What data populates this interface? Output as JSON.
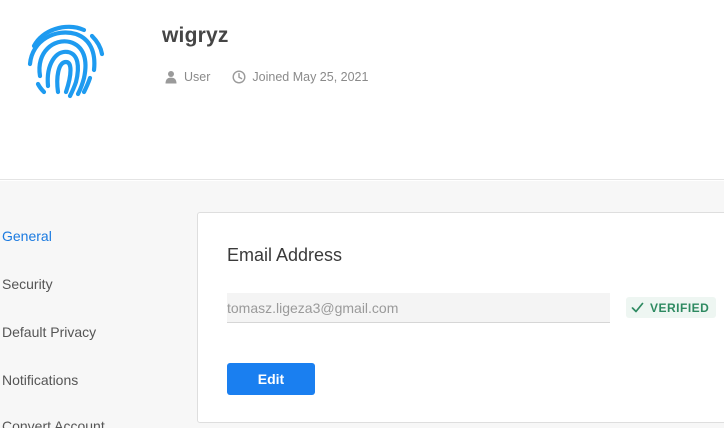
{
  "profile": {
    "username": "wigryz",
    "role": "User",
    "joined": "Joined May 25, 2021",
    "avatar_icon": "fingerprint-icon",
    "accent_color": "#1e9bf0"
  },
  "sidebar": {
    "items": [
      {
        "label": "General",
        "active": true
      },
      {
        "label": "Security",
        "active": false
      },
      {
        "label": "Default Privacy",
        "active": false
      },
      {
        "label": "Notifications",
        "active": false
      },
      {
        "label": "Convert Account",
        "active": false
      }
    ]
  },
  "email_section": {
    "title": "Email Address",
    "email_value": "tomasz.ligeza3@gmail.com",
    "verified_label": "VERIFIED",
    "edit_label": "Edit"
  },
  "colors": {
    "primary": "#1a7ff0",
    "verified": "#2e8a61",
    "active_nav": "#1a7ae0"
  }
}
